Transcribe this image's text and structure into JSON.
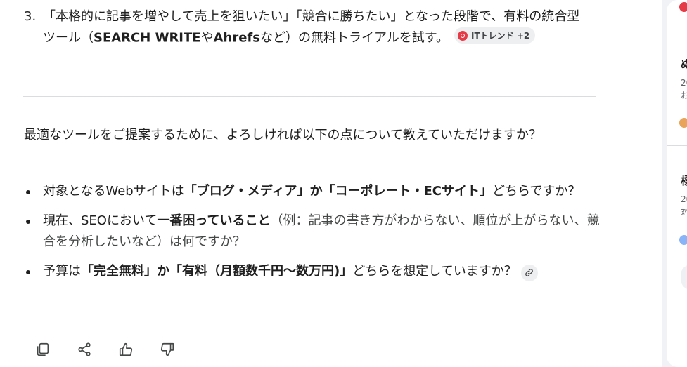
{
  "numbered_item": {
    "number": "3.",
    "seg1": "「本格的に記事を増やして売上を狙いたい」「競合に勝ちたい」となった段階で、有料の統合型ツール（",
    "bold1": "SEARCH WRITE",
    "seg2": "や",
    "bold2": "Ahrefs",
    "seg3": "など）の無料トライアルを試す。",
    "source_chip": "ITトレンド +2"
  },
  "intro": "最適なツールをご提案するために、よろしければ以下の点について教えていただけますか？",
  "bullets": [
    {
      "pre": "対象となるWebサイトは",
      "bold": "「ブログ・メディア」か「コーポレート・ECサイト」",
      "post": "どちらですか？"
    },
    {
      "pre": "現在、SEOにおいて",
      "bold": "一番困っていること",
      "post": "（例：記事の書き方がわからない、順位が上がらない、競合を分析したいなど）は何ですか？"
    },
    {
      "pre": "予算は",
      "bold": "「完全無料」か「有料（月額数千円〜数万円)」",
      "post": "どちらを想定していますか？"
    }
  ],
  "sidebar": {
    "frag1": "ぬ",
    "frag2": "20",
    "frag3": "お",
    "frag4": "標",
    "frag5": "20",
    "frag6": "対"
  },
  "colors": {
    "source_logo": "#e63a46",
    "chip_bg": "#eeeff1",
    "divider": "#dadce0"
  },
  "icons": {
    "copy": "copy-icon",
    "share": "share-icon",
    "thumbs_up": "thumbs-up-icon",
    "thumbs_down": "thumbs-down-icon",
    "link": "link-icon"
  }
}
